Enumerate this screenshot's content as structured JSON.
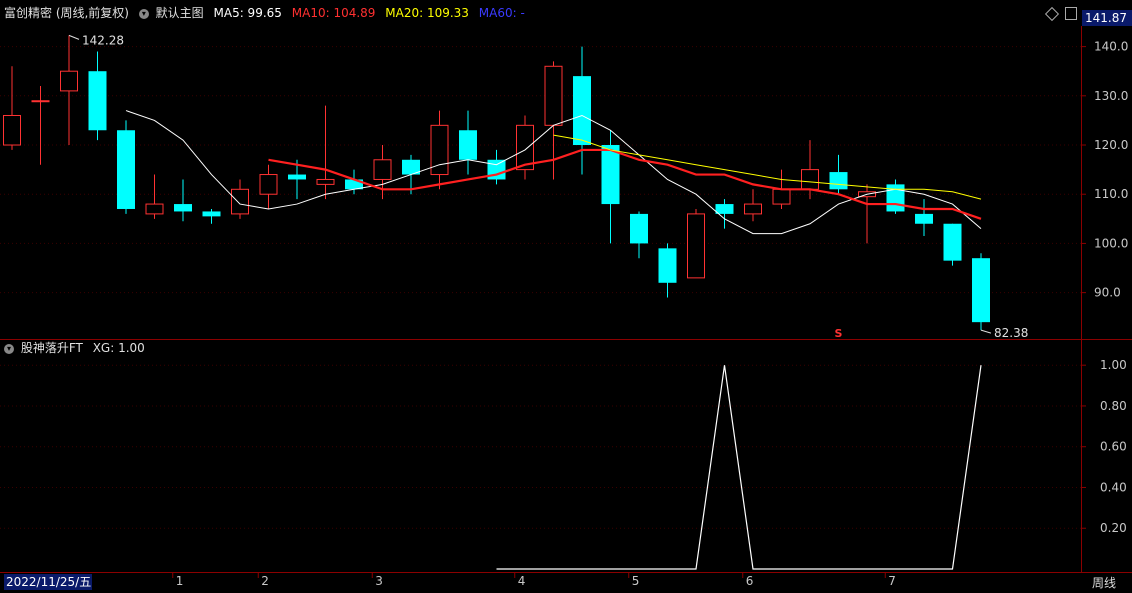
{
  "main_header": {
    "stock_title": "富创精密 (周线,前复权)",
    "indicator_group": "默认主图",
    "ma5": "MA5: 99.65",
    "ma10": "MA10: 104.89",
    "ma20": "MA20: 109.33",
    "ma60": "MA60: -",
    "right_price_box": "141.87"
  },
  "sub_header": {
    "indicator_name": "股神落升FT",
    "xg_value": "XG: 1.00"
  },
  "annotations": {
    "high_label": "142.28",
    "low_label": "82.38",
    "signal_marker": "S"
  },
  "price_axis": [
    "140.0",
    "130.0",
    "120.0",
    "110.0",
    "100.0",
    "90.0"
  ],
  "indicator_axis": [
    "1.00",
    "0.80",
    "0.60",
    "0.40",
    "0.20"
  ],
  "time_axis": {
    "date_label": "2022/11/25/五",
    "month_labels": [
      "1",
      "2",
      "3",
      "4",
      "5",
      "6",
      "7"
    ],
    "period_label": "周线"
  },
  "colors": {
    "up": "#ff3232",
    "down": "#00ffff",
    "ma5": "#ffffff",
    "ma10": "#ff2020",
    "ma20": "#ffff00",
    "ma60": "#3030ff",
    "panel_border": "#8b0000"
  },
  "chart_data": [
    {
      "type": "candlestick",
      "title": "富创精密 (周线,前复权)",
      "ylim": [
        82,
        145
      ],
      "candles": [
        {
          "o": 120,
          "c": 126,
          "h": 136,
          "l": 119
        },
        {
          "o": 129,
          "c": 129,
          "h": 132,
          "l": 116
        },
        {
          "o": 131,
          "c": 135,
          "h": 142.28,
          "l": 120
        },
        {
          "o": 135,
          "c": 123,
          "h": 139,
          "l": 121
        },
        {
          "o": 123,
          "c": 107,
          "h": 125,
          "l": 106
        },
        {
          "o": 106,
          "c": 108,
          "h": 114,
          "l": 105
        },
        {
          "o": 108,
          "c": 106.5,
          "h": 113,
          "l": 104.5
        },
        {
          "o": 106.5,
          "c": 105.5,
          "h": 107,
          "l": 104
        },
        {
          "o": 106,
          "c": 111,
          "h": 113,
          "l": 105
        },
        {
          "o": 110,
          "c": 114,
          "h": 116,
          "l": 107
        },
        {
          "o": 114,
          "c": 113,
          "h": 117,
          "l": 109
        },
        {
          "o": 112,
          "c": 113,
          "h": 128,
          "l": 109
        },
        {
          "o": 113,
          "c": 111,
          "h": 115,
          "l": 110
        },
        {
          "o": 113,
          "c": 117,
          "h": 120,
          "l": 109
        },
        {
          "o": 117,
          "c": 114,
          "h": 118,
          "l": 110
        },
        {
          "o": 114,
          "c": 124,
          "h": 127,
          "l": 111
        },
        {
          "o": 123,
          "c": 117,
          "h": 127,
          "l": 114
        },
        {
          "o": 117,
          "c": 113,
          "h": 119,
          "l": 112
        },
        {
          "o": 115,
          "c": 124,
          "h": 126,
          "l": 113
        },
        {
          "o": 124,
          "c": 136,
          "h": 137,
          "l": 113
        },
        {
          "o": 134,
          "c": 120,
          "h": 140,
          "l": 114
        },
        {
          "o": 120,
          "c": 108,
          "h": 123,
          "l": 100
        },
        {
          "o": 106,
          "c": 100,
          "h": 106.5,
          "l": 97
        },
        {
          "o": 99,
          "c": 92,
          "h": 100,
          "l": 89
        },
        {
          "o": 93,
          "c": 106,
          "h": 107,
          "l": 93
        },
        {
          "o": 108,
          "c": 106,
          "h": 109,
          "l": 103
        },
        {
          "o": 106,
          "c": 108,
          "h": 111,
          "l": 104.5
        },
        {
          "o": 108,
          "c": 111,
          "h": 115,
          "l": 107
        },
        {
          "o": 111,
          "c": 115,
          "h": 121,
          "l": 109
        },
        {
          "o": 114.5,
          "c": 111,
          "h": 118,
          "l": 110
        },
        {
          "o": 109.5,
          "c": 110.5,
          "h": 112,
          "l": 100
        },
        {
          "o": 112,
          "c": 106.5,
          "h": 113,
          "l": 106
        },
        {
          "o": 106,
          "c": 104,
          "h": 109,
          "l": 101.5
        },
        {
          "o": 104,
          "c": 96.5,
          "h": 104,
          "l": 95.5
        },
        {
          "o": 97,
          "c": 84,
          "h": 98,
          "l": 82.38
        }
      ],
      "series": [
        {
          "name": "MA5",
          "values": [
            null,
            null,
            null,
            null,
            127,
            125,
            121,
            114,
            108,
            107,
            108,
            110,
            111,
            112,
            114,
            116,
            117,
            116,
            119,
            124,
            126,
            123,
            118,
            113,
            110,
            105,
            102,
            102,
            104,
            108,
            110,
            111,
            110,
            108,
            103
          ]
        },
        {
          "name": "MA10",
          "values": [
            null,
            null,
            null,
            null,
            null,
            null,
            null,
            null,
            null,
            117,
            116,
            115,
            113,
            111,
            111,
            112,
            113,
            114,
            116,
            117,
            119,
            119,
            117,
            116,
            114,
            114,
            112,
            111,
            111,
            110,
            108,
            108,
            107,
            107,
            105
          ]
        },
        {
          "name": "MA20",
          "values": [
            null,
            null,
            null,
            null,
            null,
            null,
            null,
            null,
            null,
            null,
            null,
            null,
            null,
            null,
            null,
            null,
            null,
            null,
            null,
            122,
            121,
            119,
            118,
            117,
            116,
            115,
            114,
            113,
            112.5,
            112,
            111.5,
            111,
            111,
            110.5,
            109
          ]
        }
      ]
    },
    {
      "type": "line",
      "title": "股神落升FT",
      "ylim": [
        0,
        1.05
      ],
      "x": [
        17,
        18,
        19,
        20,
        21,
        22,
        23,
        24,
        25,
        26,
        27,
        28,
        29,
        30,
        31,
        32,
        33,
        34
      ],
      "series": [
        {
          "name": "XG",
          "values": [
            0,
            0,
            0,
            0,
            0,
            0,
            0,
            0,
            1,
            0,
            0,
            0,
            0,
            0,
            0,
            0,
            0,
            1
          ]
        }
      ]
    }
  ]
}
